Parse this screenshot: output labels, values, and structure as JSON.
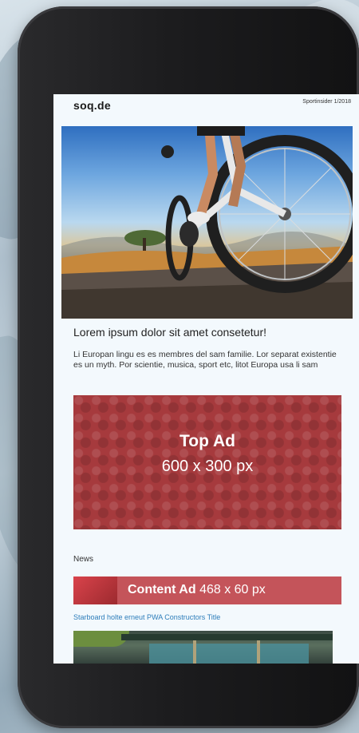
{
  "site": {
    "logo": "soq.de",
    "issue": "Sportinsider 1/2018"
  },
  "article": {
    "hero_image": "mountain-bike-rider-photo",
    "headline": "Lorem ipsum dolor sit amet consetetur!",
    "body": "Li Europan lingu es es membres del sam familie. Lor separat existentie es un myth. Por scientie, musica, sport etc, litot Europa usa li sam"
  },
  "top_ad": {
    "title": "Top Ad",
    "size": "600 x 300 px",
    "color": "#a63a3d"
  },
  "news": {
    "section_label": "News",
    "content_ad": {
      "title": "Content Ad",
      "size": "468 x 60 px",
      "color": "#c4545a"
    },
    "link_title": "Starboard holte erneut PWA Constructors Title",
    "image": "building-canopy-photo"
  },
  "colors": {
    "phone_body": "#1c1c1e",
    "screen_bg": "#f3f9fd",
    "link": "#2d7dba"
  }
}
